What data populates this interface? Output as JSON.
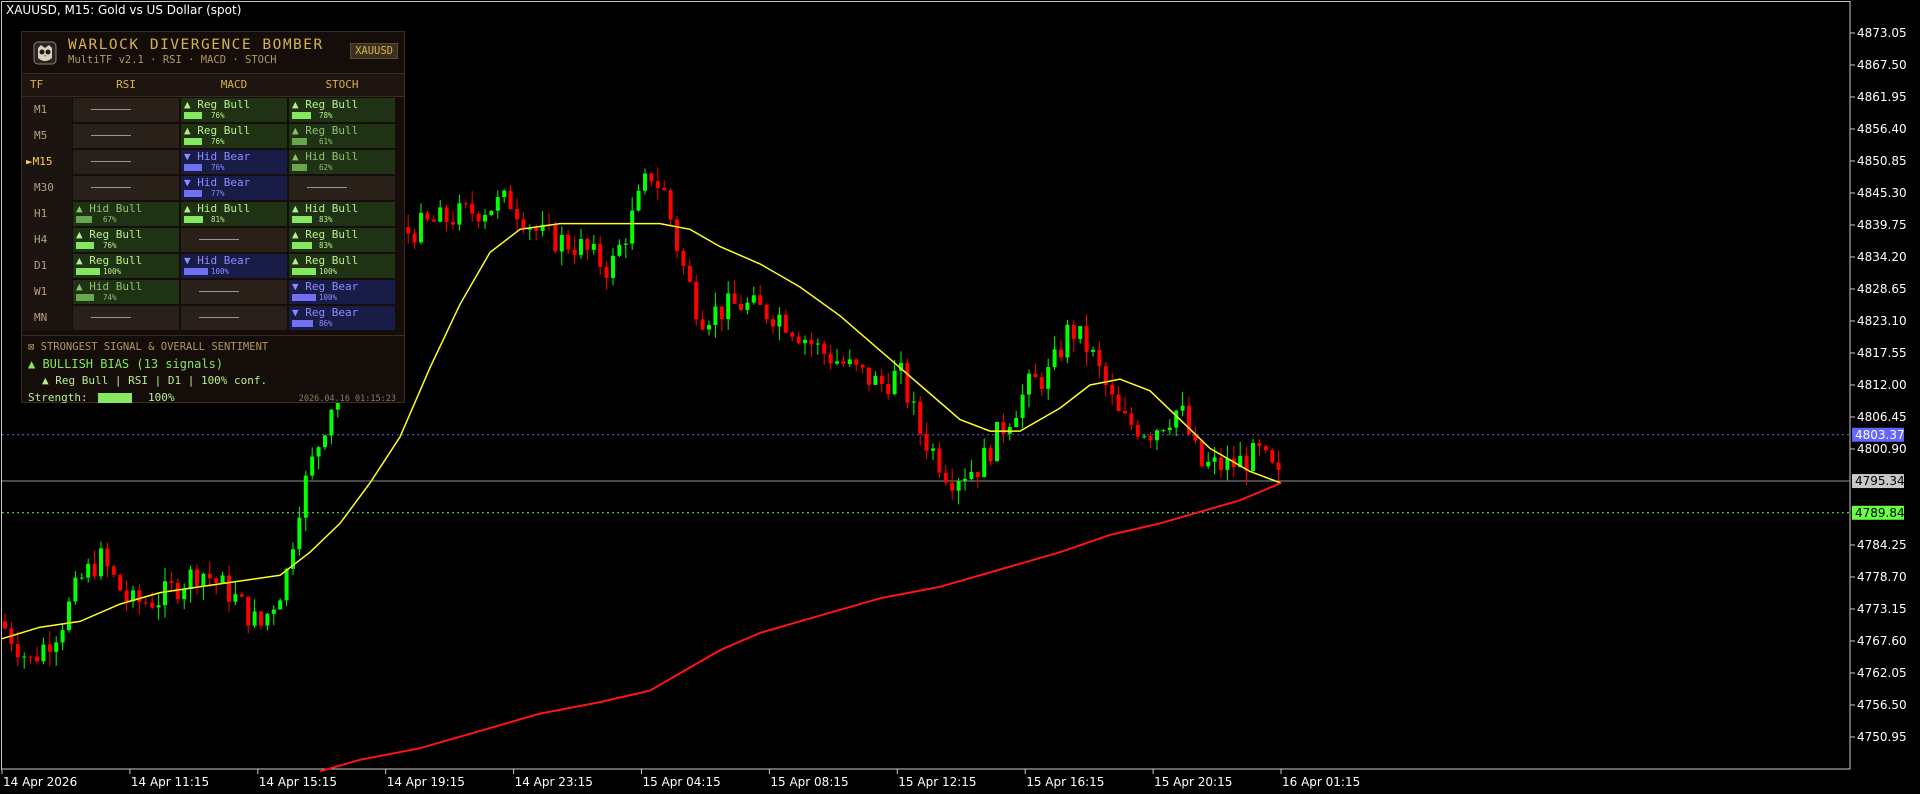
{
  "chart_title": "XAUUSD, M15:  Gold vs US Dollar (spot)",
  "price_axis_labels": [
    "4873.05",
    "4867.50",
    "4861.95",
    "4856.40",
    "4850.85",
    "4845.30",
    "4839.75",
    "4834.20",
    "4828.65",
    "4823.10",
    "4817.55",
    "4812.00",
    "4806.45",
    "4800.90",
    "4784.25",
    "4778.70",
    "4773.15",
    "4767.60",
    "4762.05",
    "4756.50",
    "4750.95"
  ],
  "time_axis_labels": [
    "14 Apr 2026",
    "14 Apr 11:15",
    "14 Apr 15:15",
    "14 Apr 19:15",
    "14 Apr 23:15",
    "15 Apr 04:15",
    "15 Apr 08:15",
    "15 Apr 12:15",
    "15 Apr 16:15",
    "15 Apr 20:15",
    "16 Apr 01:15"
  ],
  "price_boxes": {
    "blue": "4803.37",
    "current": "4795.34",
    "green": "4789.84"
  },
  "colors": {
    "bull": "#00ff00",
    "bear": "#ff0000",
    "ma_fast": "#ffff22",
    "ma_slow": "#ff1414",
    "level_blue": "#6464ff",
    "level_green": "#66ff44"
  },
  "panel": {
    "title": "WARLOCK  DIVERGENCE  BOMBER",
    "subtitle": "MultiTF v2.1  ·  RSI  ·  MACD  ·  STOCH",
    "symbol": "XAUUSD",
    "headers": [
      "TF",
      "RSI",
      "MACD",
      "STOCH"
    ],
    "rows": [
      {
        "tf": "M1",
        "active": false,
        "cells": [
          {
            "t": "none"
          },
          {
            "t": "bull",
            "label": "▲ Reg Bull",
            "pct": "76%",
            "v": 0.76
          },
          {
            "t": "bull",
            "label": "▲ Reg Bull",
            "pct": "78%",
            "v": 0.78
          }
        ]
      },
      {
        "tf": "M5",
        "active": false,
        "cells": [
          {
            "t": "none"
          },
          {
            "t": "bull",
            "label": "▲ Reg Bull",
            "pct": "76%",
            "v": 0.76
          },
          {
            "t": "hbull",
            "label": "▲ Reg Bull",
            "pct": "61%",
            "v": 0.61
          }
        ]
      },
      {
        "tf": "M15",
        "active": true,
        "cells": [
          {
            "t": "none"
          },
          {
            "t": "bear",
            "label": "▼ Hid Bear",
            "pct": "76%",
            "v": 0.76
          },
          {
            "t": "hbull",
            "label": "▲ Hid Bull",
            "pct": "62%",
            "v": 0.62
          }
        ]
      },
      {
        "tf": "M30",
        "active": false,
        "cells": [
          {
            "t": "none"
          },
          {
            "t": "bear",
            "label": "▼ Hid Bear",
            "pct": "77%",
            "v": 0.77
          },
          {
            "t": "none"
          }
        ]
      },
      {
        "tf": "H1",
        "active": false,
        "cells": [
          {
            "t": "hbull",
            "label": "▲ Hid Bull",
            "pct": "67%",
            "v": 0.67
          },
          {
            "t": "bull",
            "label": "▲ Hid Bull",
            "pct": "81%",
            "v": 0.81
          },
          {
            "t": "bull",
            "label": "▲ Hid Bull",
            "pct": "83%",
            "v": 0.83
          }
        ]
      },
      {
        "tf": "H4",
        "active": false,
        "cells": [
          {
            "t": "bull",
            "label": "▲ Reg Bull",
            "pct": "76%",
            "v": 0.76
          },
          {
            "t": "none"
          },
          {
            "t": "bull",
            "label": "▲ Reg Bull",
            "pct": "83%",
            "v": 0.83
          }
        ]
      },
      {
        "tf": "D1",
        "active": false,
        "cells": [
          {
            "t": "bull",
            "label": "▲ Reg Bull",
            "pct": "100%",
            "v": 1.0
          },
          {
            "t": "bear",
            "label": "▼ Hid Bear",
            "pct": "100%",
            "v": 1.0
          },
          {
            "t": "bull",
            "label": "▲ Reg Bull",
            "pct": "100%",
            "v": 1.0
          }
        ]
      },
      {
        "tf": "W1",
        "active": false,
        "cells": [
          {
            "t": "hbull",
            "label": "▲ Hid Bull",
            "pct": "74%",
            "v": 0.74
          },
          {
            "t": "none"
          },
          {
            "t": "bear",
            "label": "▼ Reg Bear",
            "pct": "100%",
            "v": 1.0
          }
        ]
      },
      {
        "tf": "MN",
        "active": false,
        "cells": [
          {
            "t": "none"
          },
          {
            "t": "none"
          },
          {
            "t": "bear",
            "label": "▼ Reg Bear",
            "pct": "86%",
            "v": 0.86
          }
        ]
      }
    ],
    "summary_head": "⊠  STRONGEST SIGNAL  &  OVERALL SENTIMENT",
    "bias": "▲  BULLISH BIAS  (13 signals)",
    "detail": "▲ Reg Bull  |  RSI  |  D1  |  100% conf.",
    "strength_label": "Strength:",
    "strength_value": "100%",
    "strength": 1.0,
    "timestamp": "2026.04.16 01:15:23"
  }
}
